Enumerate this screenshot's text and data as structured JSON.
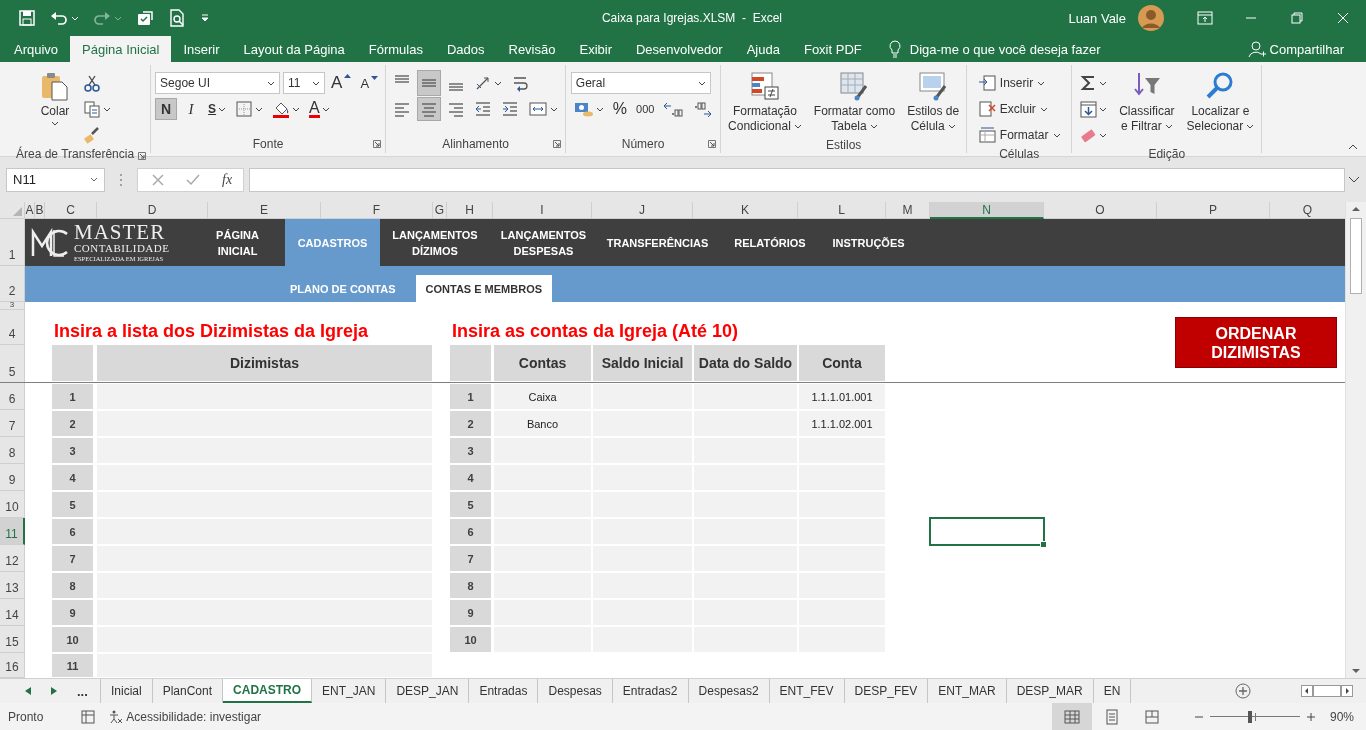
{
  "title_bar": {
    "quick_access": [
      {
        "disabled": false
      },
      {
        "disabled": false
      },
      {
        "disabled": true
      },
      {
        "disabled": false
      },
      {
        "disabled": false
      }
    ],
    "title": "Caixa para Igrejas.XLSM  -  Excel",
    "user": "Luan Vale"
  },
  "ribbon_tabs": [
    {
      "label": "Arquivo",
      "selected": false
    },
    {
      "label": "Página Inicial",
      "selected": true
    },
    {
      "label": "Inserir",
      "selected": false
    },
    {
      "label": "Layout da Página",
      "selected": false
    },
    {
      "label": "Fórmulas",
      "selected": false
    },
    {
      "label": "Dados",
      "selected": false
    },
    {
      "label": "Revisão",
      "selected": false
    },
    {
      "label": "Exibir",
      "selected": false
    },
    {
      "label": "Desenvolvedor",
      "selected": false
    },
    {
      "label": "Ajuda",
      "selected": false
    },
    {
      "label": "Foxit PDF",
      "selected": false
    }
  ],
  "tell_me": "Diga-me o que você deseja fazer",
  "share": "Compartilhar",
  "ribbon_groups": [
    {
      "label": "Área de Transferência",
      "sections": [
        {
          "kind": "big",
          "label": "Colar"
        },
        {
          "kind": "stack",
          "lines": [
            {
              "items": [
                {
                  "kind": "icon"
                }
              ]
            },
            {
              "items": [
                {
                  "kind": "icon"
                }
              ]
            },
            {
              "items": [
                {
                  "kind": "icon"
                }
              ]
            }
          ]
        }
      ]
    },
    {
      "label": "Fonte",
      "sections": [
        {
          "kind": "stack",
          "lines": [
            {
              "items": [
                {
                  "kind": "combo",
                  "value": "Segoe UI"
                },
                {
                  "kind": "combo",
                  "value": "11"
                },
                {
                  "kind": "text",
                  "label": "A"
                },
                {
                  "kind": "text",
                  "label": "A"
                }
              ]
            },
            {
              "items": [
                {
                  "kind": "toggle",
                  "label": "N",
                  "selected": true
                },
                {
                  "kind": "toggle",
                  "label": "I",
                  "selected": false
                },
                {
                  "kind": "toggle",
                  "label": "S",
                  "selected": false
                },
                {
                  "kind": "icon",
                  "selected": false
                },
                {
                  "kind": "icon",
                  "selected": false
                },
                {
                  "kind": "text",
                  "label": "A",
                  "selected": false
                }
              ]
            }
          ]
        }
      ]
    },
    {
      "label": "Alinhamento",
      "sections": [
        {
          "kind": "stack",
          "lines": [
            {
              "items": [
                {
                  "kind": "icon",
                  "selected": false
                },
                {
                  "kind": "icon",
                  "selected": true
                },
                {
                  "kind": "icon",
                  "selected": false
                },
                {
                  "kind": "icon",
                  "selected": false
                },
                {
                  "kind": "icon",
                  "selected": false
                }
              ]
            },
            {
              "items": [
                {
                  "kind": "icon",
                  "selected": false
                },
                {
                  "kind": "icon",
                  "selected": true
                },
                {
                  "kind": "icon",
                  "selected": false
                },
                {
                  "kind": "icon",
                  "selected": false
                },
                {
                  "kind": "icon",
                  "selected": false
                },
                {
                  "kind": "icon",
                  "selected": false
                }
              ]
            }
          ]
        }
      ]
    },
    {
      "label": "Número",
      "sections": [
        {
          "kind": "stack",
          "lines": [
            {
              "items": [
                {
                  "kind": "combo",
                  "value": "Geral"
                }
              ]
            },
            {
              "items": [
                {
                  "kind": "icon"
                },
                {
                  "kind": "text",
                  "label": "%"
                },
                {
                  "kind": "text",
                  "label": "000"
                },
                {
                  "kind": "icon"
                },
                {
                  "kind": "icon"
                }
              ]
            }
          ]
        }
      ]
    },
    {
      "label": "Estilos",
      "sections": [
        {
          "kind": "big",
          "label": "Formatação\nCondicional"
        },
        {
          "kind": "big",
          "label": "Formatar como\nTabela"
        },
        {
          "kind": "big",
          "label": "Estilos de\nCélula"
        }
      ]
    },
    {
      "label": "Células",
      "sections": [
        {
          "kind": "stack",
          "lines": [
            {
              "items": [
                {
                  "kind": "menu",
                  "label": "Inserir"
                }
              ]
            },
            {
              "items": [
                {
                  "kind": "menu",
                  "label": "Excluir"
                }
              ]
            },
            {
              "items": [
                {
                  "kind": "menu",
                  "label": "Formatar"
                }
              ]
            }
          ]
        }
      ]
    },
    {
      "label": "Edição",
      "sections": [
        {
          "kind": "stack",
          "lines": [
            {
              "items": [
                {
                  "kind": "icon"
                }
              ]
            },
            {
              "items": [
                {
                  "kind": "icon"
                }
              ]
            },
            {
              "items": [
                {
                  "kind": "icon"
                }
              ]
            }
          ]
        },
        {
          "kind": "big",
          "label": "Classificar\ne Filtrar"
        },
        {
          "kind": "big",
          "label": "Localizar e\nSelecionar"
        }
      ]
    }
  ],
  "formula_bar": {
    "name_box": "N11",
    "function_label": "fx"
  },
  "sheet": {
    "columns": [
      {
        "label": "A",
        "selected": false
      },
      {
        "label": "B",
        "selected": false
      },
      {
        "label": "C",
        "selected": false
      },
      {
        "label": "D",
        "selected": false
      },
      {
        "label": "E",
        "selected": false
      },
      {
        "label": "F",
        "selected": false
      },
      {
        "label": "G",
        "selected": false
      },
      {
        "label": "H",
        "selected": false
      },
      {
        "label": "I",
        "selected": false
      },
      {
        "label": "J",
        "selected": false
      },
      {
        "label": "K",
        "selected": false
      },
      {
        "label": "L",
        "selected": false
      },
      {
        "label": "M",
        "selected": false
      },
      {
        "label": "N",
        "selected": true
      },
      {
        "label": "O",
        "selected": false
      },
      {
        "label": "P",
        "selected": false
      },
      {
        "label": "Q",
        "selected": false
      }
    ],
    "rows": [
      {
        "label": "1",
        "selected": false
      },
      {
        "label": "2",
        "selected": false
      },
      {
        "label": "3",
        "selected": false
      },
      {
        "label": "4",
        "selected": false
      },
      {
        "label": "5",
        "selected": false
      },
      {
        "label": "6",
        "selected": false
      },
      {
        "label": "7",
        "selected": false
      },
      {
        "label": "8",
        "selected": false
      },
      {
        "label": "9",
        "selected": false
      },
      {
        "label": "10",
        "selected": false
      },
      {
        "label": "11",
        "selected": true
      },
      {
        "label": "12",
        "selected": false
      },
      {
        "label": "13",
        "selected": false
      },
      {
        "label": "14",
        "selected": false
      },
      {
        "label": "15",
        "selected": false
      },
      {
        "label": "16",
        "selected": false
      }
    ],
    "logo": {
      "title": "MASTER",
      "subtitle": "CONTABILIDADE",
      "tagline": "ESPECIALIZADA EM IGREJAS"
    },
    "nav": [
      {
        "label": "PÁGINA\nINICIAL",
        "selected": false
      },
      {
        "label": "CADASTROS",
        "selected": true
      },
      {
        "label": "LANÇAMENTOS\nDÍZIMOS",
        "selected": false
      },
      {
        "label": "LANÇAMENTOS\nDESPESAS",
        "selected": false
      },
      {
        "label": "TRANSFERÊNCIAS",
        "selected": false
      },
      {
        "label": "RELATÓRIOS",
        "selected": false
      },
      {
        "label": "INSTRUÇÕES",
        "selected": false
      }
    ],
    "sub_tabs": [
      {
        "label": "PLANO DE CONTAS",
        "selected": false
      },
      {
        "label": "CONTAS E MEMBROS",
        "selected": true
      }
    ],
    "members": {
      "title": "Insira a lista dos Dizimistas da Igreja",
      "header": "Dizimistas",
      "numbers": [
        "1",
        "2",
        "3",
        "4",
        "5",
        "6",
        "7",
        "8",
        "9",
        "10",
        "11"
      ]
    },
    "accounts": {
      "title": "Insira as contas da Igreja (Até 10)",
      "columns": [
        "Contas",
        "Saldo Inicial",
        "Data do Saldo",
        "Conta"
      ],
      "rows": [
        {
          "number": "1",
          "name": "Caixa",
          "code": "1.1.1.01.001"
        },
        {
          "number": "2",
          "name": "Banco",
          "code": "1.1.1.02.001"
        },
        {
          "number": "3"
        },
        {
          "number": "4"
        },
        {
          "number": "5"
        },
        {
          "number": "6"
        },
        {
          "number": "7"
        },
        {
          "number": "8"
        },
        {
          "number": "9"
        },
        {
          "number": "10"
        }
      ]
    },
    "sort_button": "ORDENAR DIZIMISTAS"
  },
  "sheet_tabs": {
    "more": "...",
    "tabs": [
      {
        "label": "Inicial",
        "selected": false
      },
      {
        "label": "PlanCont",
        "selected": false
      },
      {
        "label": "CADASTRO",
        "selected": true
      },
      {
        "label": "ENT_JAN",
        "selected": false
      },
      {
        "label": "DESP_JAN",
        "selected": false
      },
      {
        "label": "Entradas",
        "selected": false
      },
      {
        "label": "Despesas",
        "selected": false
      },
      {
        "label": "Entradas2",
        "selected": false
      },
      {
        "label": "Despesas2",
        "selected": false
      },
      {
        "label": "ENT_FEV",
        "selected": false
      },
      {
        "label": "DESP_FEV",
        "selected": false
      },
      {
        "label": "ENT_MAR",
        "selected": false
      },
      {
        "label": "DESP_MAR",
        "selected": false
      },
      {
        "label": "EN",
        "selected": false
      }
    ]
  },
  "status_bar": {
    "status": "Pronto",
    "accessibility": "Acessibilidade: investigar",
    "views": [
      {
        "selected": true
      },
      {
        "selected": false
      },
      {
        "selected": false
      }
    ],
    "zoom": {
      "level": 0.45,
      "reading": "90%"
    }
  }
}
